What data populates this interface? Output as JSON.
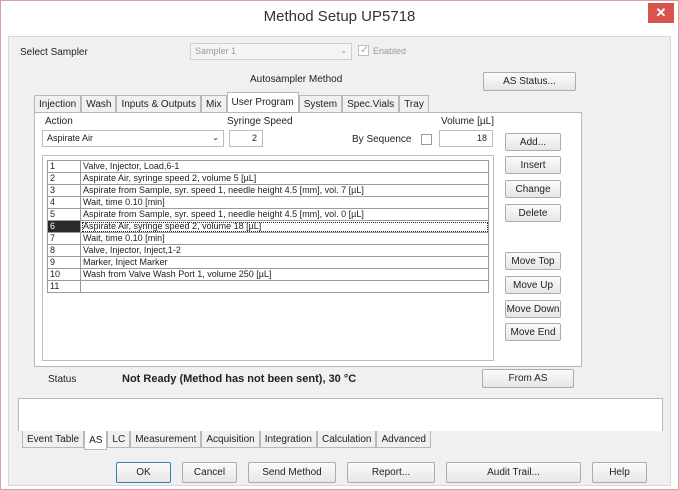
{
  "window": {
    "title": "Method Setup UP5718",
    "close_glyph": "✕"
  },
  "sampler": {
    "label": "Select Sampler",
    "value": "Sampler 1",
    "enabled_label": "Enabled",
    "enabled_checked": true
  },
  "as_status_button": "AS Status...",
  "autosampler_heading": "Autosampler Method",
  "top_tabs": [
    "Injection",
    "Wash",
    "Inputs & Outputs",
    "Mix",
    "User Program",
    "System",
    "Spec.Vials",
    "Tray"
  ],
  "active_top_tab": "User Program",
  "action": {
    "label": "Action",
    "value": "Aspirate Air"
  },
  "syringe_speed": {
    "label": "Syringe Speed",
    "value": "2"
  },
  "by_sequence_label": "By Sequence",
  "volume": {
    "label": "Volume [µL]",
    "value": "18"
  },
  "program_rows": [
    {
      "num": "1",
      "text": "Valve, Injector, Load,6-1"
    },
    {
      "num": "2",
      "text": "Aspirate Air, syringe speed 2, volume 5 [µL]"
    },
    {
      "num": "3",
      "text": "Aspirate from Sample, syr. speed 1, needle height 4.5 [mm], vol. 7 [µL]"
    },
    {
      "num": "4",
      "text": "Wait, time 0.10 [min]"
    },
    {
      "num": "5",
      "text": "Aspirate from Sample, syr. speed 1, needle height 4.5 [mm], vol. 0 [µL]"
    },
    {
      "num": "6",
      "text": "Aspirate Air, syringe speed 2, volume 18 [µL]"
    },
    {
      "num": "7",
      "text": "Wait, time 0.10 [min]"
    },
    {
      "num": "8",
      "text": "Valve, Injector, Inject,1-2"
    },
    {
      "num": "9",
      "text": "Marker, Inject Marker"
    },
    {
      "num": "10",
      "text": "Wash from Valve Wash Port 1, volume 250 [µL]"
    },
    {
      "num": "11",
      "text": ""
    }
  ],
  "selected_row": "6",
  "side_buttons": {
    "add": "Add...",
    "insert": "Insert",
    "change": "Change",
    "delete": "Delete",
    "move_top": "Move Top",
    "move_up": "Move Up",
    "move_down": "Move Down",
    "move_end": "Move End"
  },
  "status": {
    "label": "Status",
    "text": "Not Ready (Method has not been sent), 30 °C"
  },
  "from_as_button": "From AS",
  "bottom_tabs": [
    "Event Table",
    "AS",
    "LC",
    "Measurement",
    "Acquisition",
    "Integration",
    "Calculation",
    "Advanced"
  ],
  "active_bottom_tab": "AS",
  "footer_buttons": {
    "ok": "OK",
    "cancel": "Cancel",
    "send_method": "Send Method",
    "report": "Report...",
    "audit_trail": "Audit Trail...",
    "help": "Help"
  },
  "colors": {
    "close_button": "#d9534f",
    "selected_row_bg": "#2a2a2a",
    "check_mark": "#3a7bd5"
  }
}
